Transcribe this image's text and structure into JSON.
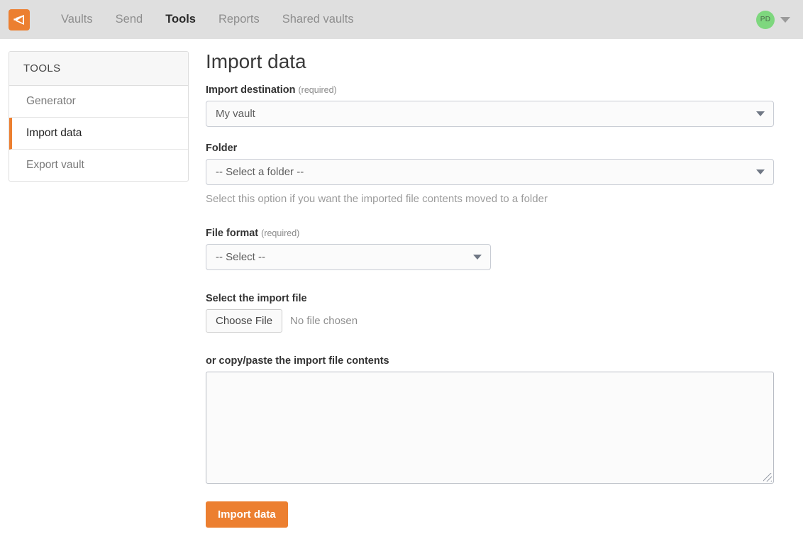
{
  "topbar": {
    "logo_icon": "bitwarden-shield-logo",
    "nav": [
      {
        "label": "Vaults",
        "active": false
      },
      {
        "label": "Send",
        "active": false
      },
      {
        "label": "Tools",
        "active": true
      },
      {
        "label": "Reports",
        "active": false
      },
      {
        "label": "Shared vaults",
        "active": false
      }
    ],
    "account": {
      "initials": "PD",
      "avatar_color": "#7ed77e",
      "caret_icon": "chevron-down-icon"
    },
    "background_color": "#dfdfdf"
  },
  "sidebar": {
    "header": "TOOLS",
    "items": [
      {
        "label": "Generator",
        "active": false
      },
      {
        "label": "Import data",
        "active": true
      },
      {
        "label": "Export vault",
        "active": false
      }
    ],
    "active_accent_color": "#ec7f30"
  },
  "main": {
    "title": "Import data",
    "import_destination": {
      "label": "Import destination",
      "required_note": "(required)",
      "value": "My vault",
      "caret_icon": "chevron-down-icon"
    },
    "folder": {
      "label": "Folder",
      "value": "-- Select a folder --",
      "help": "Select this option if you want the imported file contents moved to a folder",
      "caret_icon": "chevron-down-icon"
    },
    "file_format": {
      "label": "File format",
      "required_note": "(required)",
      "value": "-- Select --",
      "caret_icon": "chevron-down-icon"
    },
    "import_file": {
      "label": "Select the import file",
      "button_label": "Choose File",
      "status": "No file chosen"
    },
    "paste_contents": {
      "label": "or copy/paste the import file contents",
      "value": "",
      "resize_icon": "resize-grip-icon"
    },
    "submit": {
      "label": "Import data",
      "color": "#ec7f30"
    }
  }
}
